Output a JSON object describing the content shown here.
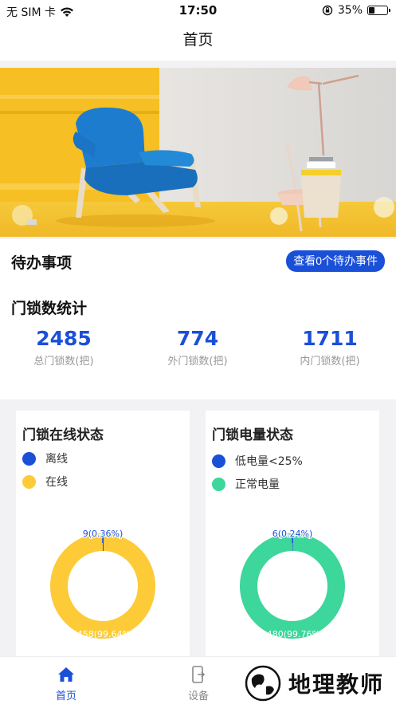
{
  "status_bar": {
    "carrier": "无 SIM 卡",
    "time": "17:50",
    "battery": "35%",
    "battery_level": 0.35
  },
  "header": {
    "title": "首页"
  },
  "todo": {
    "title": "待办事项",
    "button_label": "查看0个待办事件"
  },
  "stats": {
    "title": "门锁数统计",
    "items": [
      {
        "value": "2485",
        "label": "总门锁数(把)"
      },
      {
        "value": "774",
        "label": "外门锁数(把)"
      },
      {
        "value": "1711",
        "label": "内门锁数(把)"
      }
    ]
  },
  "online_chart": {
    "title": "门锁在线状态",
    "legend": [
      {
        "label": "离线",
        "color": "#1a4fd8"
      },
      {
        "label": "在线",
        "color": "#fccb37"
      }
    ],
    "slice_labels": [
      "9(0.36%)",
      "2458(99.64%)"
    ]
  },
  "battery_chart": {
    "title": "门锁电量状态",
    "legend": [
      {
        "label": "低电量<25%",
        "color": "#1a4fd8"
      },
      {
        "label": "正常电量",
        "color": "#3dd69b"
      }
    ],
    "slice_labels": [
      "6(0.24%)",
      "2480(99.76%)"
    ]
  },
  "chart_data": [
    {
      "type": "pie",
      "title": "门锁在线状态",
      "categories": [
        "离线",
        "在线"
      ],
      "values": [
        9,
        2458
      ],
      "percentages": [
        0.36,
        99.64
      ]
    },
    {
      "type": "pie",
      "title": "门锁电量状态",
      "categories": [
        "低电量<25%",
        "正常电量"
      ],
      "values": [
        6,
        2480
      ],
      "percentages": [
        0.24,
        99.76
      ]
    }
  ],
  "tabs": [
    {
      "label": "首页",
      "icon": "home-icon",
      "active": true
    },
    {
      "label": "设备",
      "icon": "device-icon",
      "active": false
    }
  ],
  "watermark": {
    "text": "地理教师"
  },
  "colors": {
    "accent": "#1a4fd8",
    "online": "#fccb37",
    "normal_battery": "#3dd69b",
    "inactive_tab": "#888888"
  }
}
